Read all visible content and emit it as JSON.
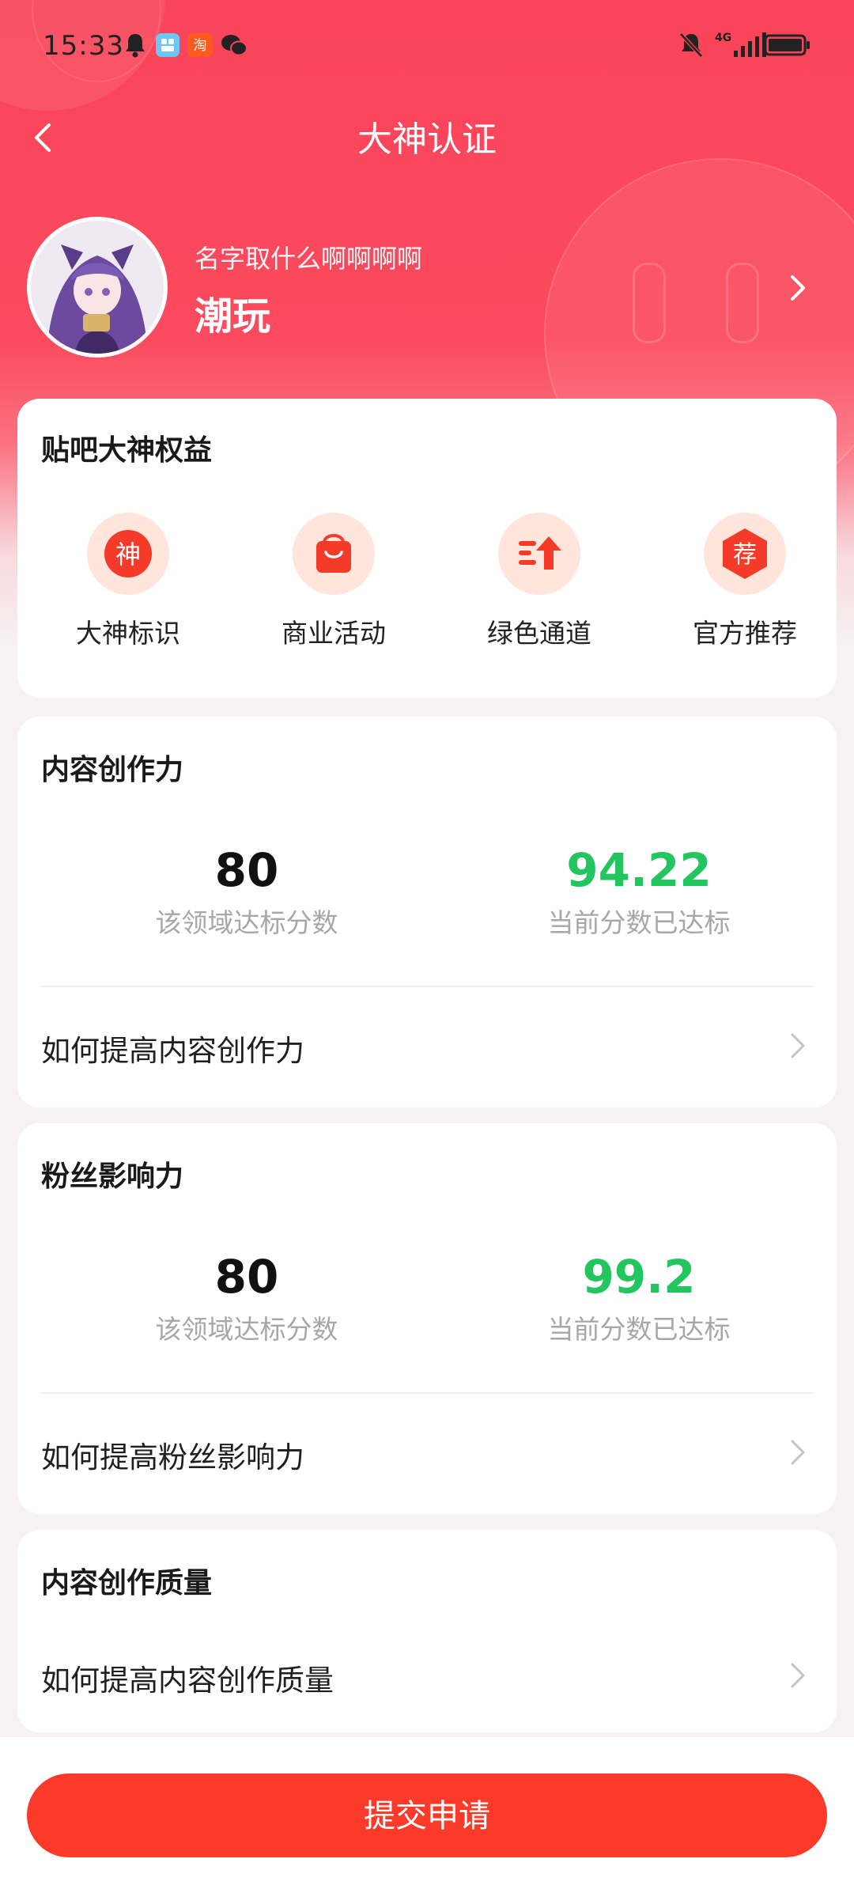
{
  "status_bar": {
    "time": "15:33",
    "network": "4G"
  },
  "nav": {
    "title": "大神认证"
  },
  "profile": {
    "nickname": "名字取什么啊啊啊啊",
    "role": "潮玩"
  },
  "benefits": {
    "title": "贴吧大神权益",
    "items": [
      {
        "label": "大神标识",
        "icon": "shen-badge-icon",
        "glyph": "神"
      },
      {
        "label": "商业活动",
        "icon": "shopping-bag-icon"
      },
      {
        "label": "绿色通道",
        "icon": "fast-track-icon"
      },
      {
        "label": "官方推荐",
        "icon": "recommend-badge-icon",
        "glyph": "荐"
      }
    ]
  },
  "sections": [
    {
      "title": "内容创作力",
      "target_score": "80",
      "target_caption": "该领域达标分数",
      "current_score": "94.22",
      "current_caption": "当前分数已达标",
      "link": "如何提高内容创作力"
    },
    {
      "title": "粉丝影响力",
      "target_score": "80",
      "target_caption": "该领域达标分数",
      "current_score": "99.2",
      "current_caption": "当前分数已达标",
      "link": "如何提高粉丝影响力"
    },
    {
      "title": "内容创作质量",
      "link": "如何提高内容创作质量"
    }
  ],
  "colors": {
    "brand_red": "#f9445a",
    "accent_green": "#22c55e",
    "submit_red": "#fc3a2a"
  },
  "submit": {
    "label": "提交申请"
  }
}
